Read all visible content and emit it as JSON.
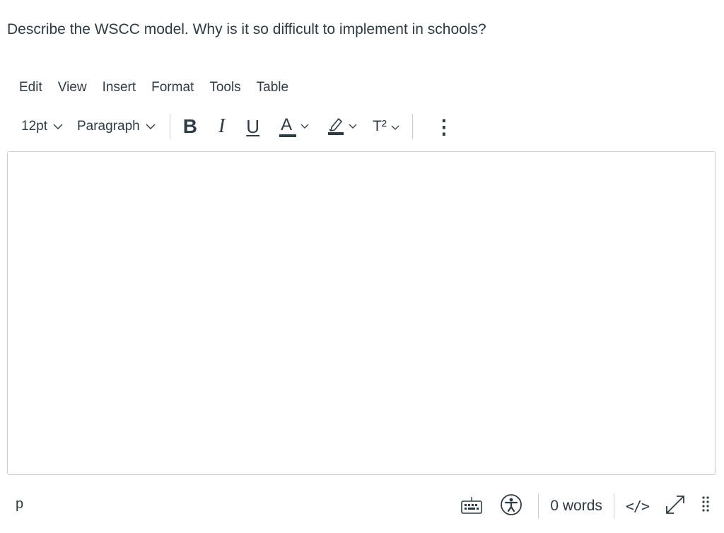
{
  "question": {
    "text": "Describe the WSCC model.  Why is it so difficult to implement in schools?"
  },
  "menubar": {
    "items": [
      "Edit",
      "View",
      "Insert",
      "Format",
      "Tools",
      "Table"
    ]
  },
  "toolbar": {
    "font_size": "12pt",
    "block_format": "Paragraph",
    "bold_label": "B",
    "italic_label": "I",
    "underline_label": "U",
    "text_color_label": "A",
    "superscript_label": "T²",
    "more_label": "⋮"
  },
  "editor": {
    "content": ""
  },
  "statusbar": {
    "path": "p",
    "word_count": "0 words",
    "html_toggle": "</>"
  },
  "colors": {
    "text": "#2d3b45",
    "border": "#c7cdd1",
    "highlight": "#2d3b45"
  },
  "icons": [
    "chevron-down-icon",
    "highlighter-icon",
    "keyboard-icon",
    "accessibility-icon",
    "fullscreen-icon",
    "resize-grip-icon"
  ]
}
